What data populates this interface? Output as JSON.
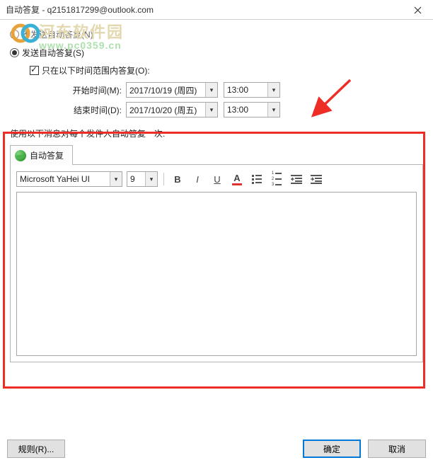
{
  "window": {
    "title": "自动答复 - q2151817299@outlook.com"
  },
  "watermark": {
    "text": "河东软件园",
    "url": "www.pc0359.cn"
  },
  "options": {
    "no_auto_reply": "不发送自动答复(N)",
    "send_auto_reply": "发送自动答复(S)",
    "time_range": "只在以下时间范围内答复(O):",
    "start_label": "开始时间(M):",
    "end_label": "结束时间(D):",
    "start_date": "2017/10/19 (周四)",
    "end_date": "2017/10/20 (周五)",
    "start_time": "13:00",
    "end_time": "13:00"
  },
  "section": {
    "label": "使用以下消息对每个发件人自动答复一次:",
    "tab": "自动答复"
  },
  "toolbar": {
    "font": "Microsoft YaHei UI",
    "size": "9",
    "bold": "B",
    "italic": "I",
    "underline": "U",
    "fontcolor": "A"
  },
  "body": {
    "text": ""
  },
  "footer": {
    "rules": "规则(R)...",
    "ok": "确定",
    "cancel": "取消"
  }
}
